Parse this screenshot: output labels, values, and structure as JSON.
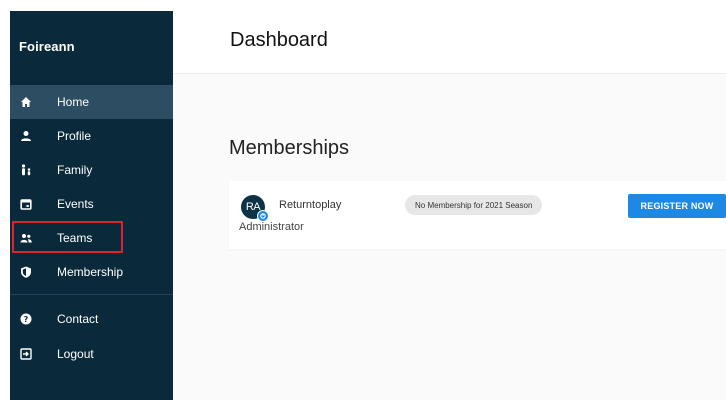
{
  "sidebar": {
    "brand": "Foireann",
    "items": [
      {
        "label": "Home",
        "icon": "home-icon",
        "active": true
      },
      {
        "label": "Profile",
        "icon": "person-icon"
      },
      {
        "label": "Family",
        "icon": "family-icon"
      },
      {
        "label": "Events",
        "icon": "calendar-icon"
      },
      {
        "label": "Teams",
        "icon": "group-icon"
      },
      {
        "label": "Membership",
        "icon": "shield-icon"
      },
      {
        "label": "Contact",
        "icon": "help-icon"
      },
      {
        "label": "Logout",
        "icon": "logout-icon"
      }
    ]
  },
  "header": {
    "title": "Dashboard"
  },
  "memberships": {
    "title": "Memberships",
    "card": {
      "avatar_initials": "RA",
      "name": "Returntoplay",
      "role": "Administrator",
      "status": "No Membership for 2021 Season",
      "register_label": "REGISTER NOW"
    }
  },
  "colors": {
    "sidebar_bg": "#0a2a3b",
    "sidebar_active": "#2c4d62",
    "accent": "#1e88e5",
    "highlight": "#e0222a"
  }
}
